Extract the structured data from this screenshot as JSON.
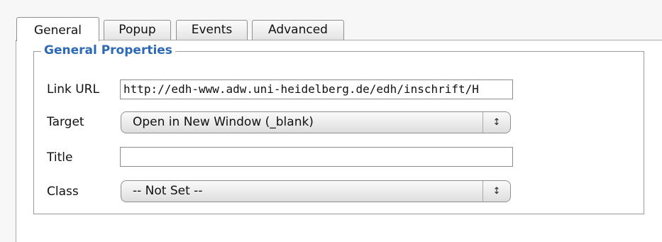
{
  "tabs": [
    {
      "label": "General",
      "active": true
    },
    {
      "label": "Popup",
      "active": false
    },
    {
      "label": "Events",
      "active": false
    },
    {
      "label": "Advanced",
      "active": false
    }
  ],
  "fieldset": {
    "legend": "General Properties"
  },
  "fields": {
    "link_url": {
      "label": "Link URL",
      "value": "http://edh-www.adw.uni-heidelberg.de/edh/inschrift/H"
    },
    "target": {
      "label": "Target",
      "selected": "Open in New Window (_blank)",
      "arrow_icon": "up-down-arrows-icon"
    },
    "title": {
      "label": "Title",
      "value": ""
    },
    "class": {
      "label": "Class",
      "selected": "-- Not Set --",
      "arrow_icon": "up-down-arrows-icon"
    }
  }
}
